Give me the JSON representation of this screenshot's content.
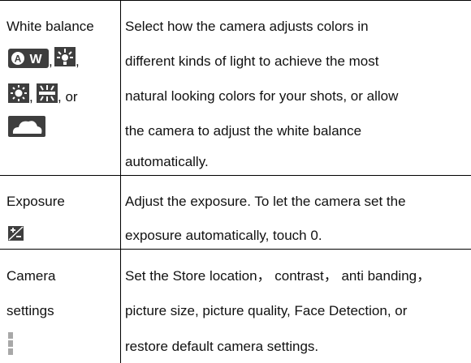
{
  "rows": [
    {
      "label": "White balance",
      "icon_separators": [
        ", ",
        ", ",
        ", ",
        ", or"
      ],
      "icons": [
        "auto-white-balance-icon",
        "incandescent-icon",
        "daylight-icon",
        "fluorescent-icon",
        "cloudy-icon"
      ],
      "desc_lines": [
        "Select how the camera adjusts colors in",
        "different kinds of light to achieve the most",
        "natural looking colors for your shots, or allow",
        "the camera to adjust the white balance",
        "automatically."
      ]
    },
    {
      "label": "Exposure",
      "icons": [
        "exposure-icon"
      ],
      "desc_lines": [
        "Adjust the exposure. To let the camera set the",
        "exposure automatically, touch 0."
      ]
    },
    {
      "label_lines": [
        "Camera",
        "settings"
      ],
      "icons": [
        "menu-dots-icon"
      ],
      "desc_lines": [
        "Set the Store location， contrast， anti banding，",
        "picture size, picture quality, Face Detection, or",
        "restore default camera settings."
      ]
    }
  ]
}
